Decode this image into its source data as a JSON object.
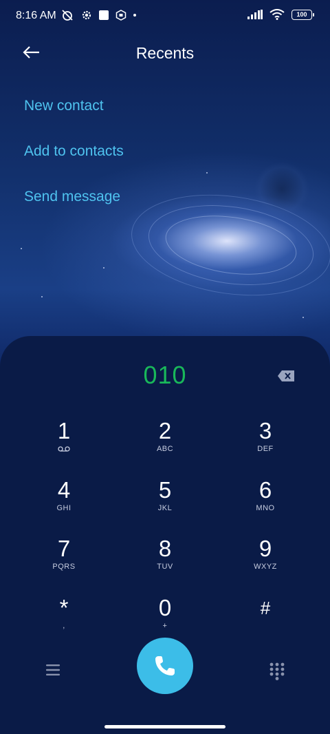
{
  "status_bar": {
    "time": "8:16 AM",
    "battery": "100"
  },
  "header": {
    "title": "Recents"
  },
  "actions": {
    "new_contact": "New contact",
    "add_to_contacts": "Add to contacts",
    "send_message": "Send message"
  },
  "dialer": {
    "number": "010",
    "keys": [
      {
        "digit": "1",
        "letters": ""
      },
      {
        "digit": "2",
        "letters": "ABC"
      },
      {
        "digit": "3",
        "letters": "DEF"
      },
      {
        "digit": "4",
        "letters": "GHI"
      },
      {
        "digit": "5",
        "letters": "JKL"
      },
      {
        "digit": "6",
        "letters": "MNO"
      },
      {
        "digit": "7",
        "letters": "PQRS"
      },
      {
        "digit": "8",
        "letters": "TUV"
      },
      {
        "digit": "9",
        "letters": "WXYZ"
      },
      {
        "digit": "*",
        "letters": ","
      },
      {
        "digit": "0",
        "letters": "+"
      },
      {
        "digit": "#",
        "letters": ""
      }
    ]
  },
  "colors": {
    "accent_link": "#4fc3ef",
    "number_green": "#19b85a",
    "call_button": "#3cbde8",
    "dialer_bg": "#0a1b47"
  },
  "icons": {
    "back": "arrow-left-icon",
    "backspace": "backspace-icon",
    "voicemail": "voicemail-icon",
    "menu": "menu-icon",
    "call": "phone-icon",
    "keypad": "dialpad-icon"
  }
}
